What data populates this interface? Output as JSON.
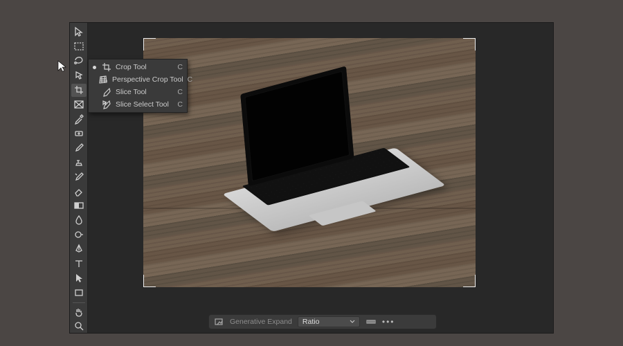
{
  "flyout": {
    "items": [
      {
        "label": "Crop Tool",
        "key": "C",
        "active": true
      },
      {
        "label": "Perspective Crop Tool",
        "key": "C",
        "active": false
      },
      {
        "label": "Slice Tool",
        "key": "C",
        "active": false
      },
      {
        "label": "Slice Select Tool",
        "key": "C",
        "active": false
      }
    ]
  },
  "optionsBar": {
    "generativeLabel": "Generative Expand",
    "ratioLabel": "Ratio",
    "more": "•••"
  },
  "tools": {
    "names": [
      "move-tool",
      "marquee-tool",
      "lasso-tool",
      "quick-select-tool",
      "crop-tool",
      "frame-tool",
      "eyedropper-tool",
      "healing-brush-tool",
      "brush-tool",
      "clone-stamp-tool",
      "history-brush-tool",
      "eraser-tool",
      "gradient-tool",
      "blur-tool",
      "dodge-tool",
      "pen-tool",
      "type-tool",
      "path-select-tool",
      "rectangle-tool",
      "hand-tool",
      "zoom-tool"
    ],
    "selectedIndex": 4
  }
}
